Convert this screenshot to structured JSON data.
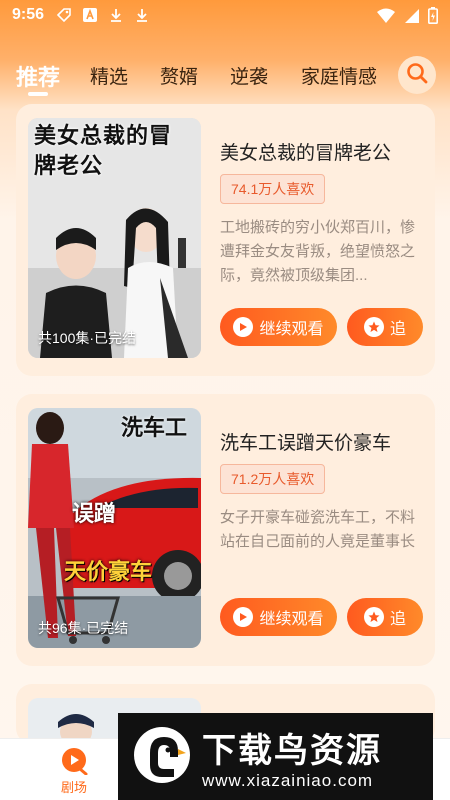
{
  "status": {
    "time": "9:56"
  },
  "tabs": [
    {
      "label": "推荐",
      "active": true
    },
    {
      "label": "精选"
    },
    {
      "label": "赘婿"
    },
    {
      "label": "逆袭"
    },
    {
      "label": "家庭情感"
    }
  ],
  "cards": [
    {
      "cover_title": "美女总裁的冒牌老公",
      "caption": "共100集·已完结",
      "title": "美女总裁的冒牌老公",
      "likes": "74.1万人喜欢",
      "desc": "工地搬砖的穷小伙郑百川，惨遭拜金女友背叛，绝望愤怒之际，竟然被顶级集团...",
      "watch_label": "继续观看",
      "follow_label": "追"
    },
    {
      "cover_title_top": "洗车工",
      "cover_title_mid": "误蹭",
      "cover_title_bottom": "天价豪车",
      "caption": "共96集·已完结",
      "title": "洗车工误蹭天价豪车",
      "likes": "71.2万人喜欢",
      "desc": "女子开豪车碰瓷洗车工，不料站在自己面前的人竟是董事长",
      "watch_label": "继续观看",
      "follow_label": "追"
    }
  ],
  "nav": {
    "theater_label": "剧场"
  },
  "watermark": {
    "title": "下载鸟资源",
    "url": "www.xiazainiao.com"
  },
  "colors": {
    "accent": "#ff6a1a",
    "header": "#ff9a3c"
  }
}
